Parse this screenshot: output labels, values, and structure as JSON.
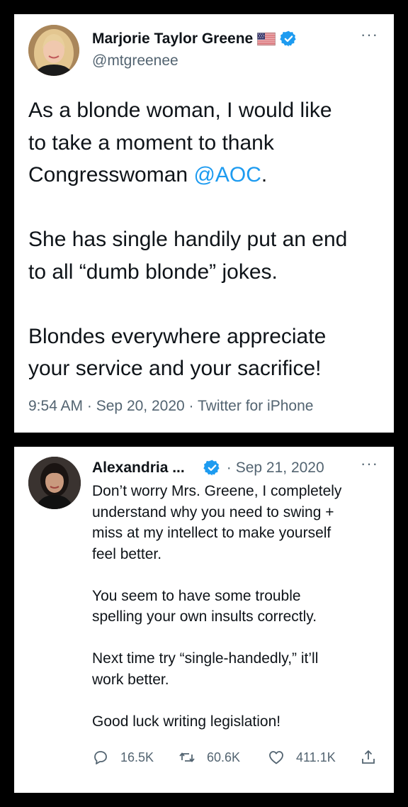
{
  "tweet_1": {
    "display_name": "Marjorie Taylor Greene",
    "handle": "@mtgreenee",
    "text_before_mention": "As a blonde woman, I would like\nto take a moment to thank\nCongresswoman ",
    "mention": "@AOC",
    "text_after_mention": ".\n\nShe has single handily put an end\nto all “dumb blonde” jokes.\n\nBlondes everywhere appreciate\nyour service and your sacrifice!",
    "time": "9:54 AM",
    "date": "Sep 20, 2020",
    "source": "Twitter for iPhone",
    "meta_separator": "·",
    "more_label": "···"
  },
  "tweet_2": {
    "display_name": "Alexandria ...",
    "date_separator": "·",
    "date": "Sep 21, 2020",
    "text": "Don’t worry Mrs. Greene, I completely\nunderstand why you need to swing +\nmiss at my intellect to make yourself\nfeel better.\n\nYou seem to have some trouble\nspelling your own insults correctly.\n\nNext time try “single-handedly,” it’ll\nwork better.\n\nGood luck writing legislation!",
    "more_label": "···",
    "replies": "16.5K",
    "retweets": "60.6K",
    "likes": "411.1K"
  },
  "colors": {
    "link": "#1d9bf0",
    "secondary_text": "#536471",
    "verified_badge": "#1d9bf0"
  },
  "icons": [
    "us-flag-icon",
    "verified-badge-icon",
    "more-icon",
    "reply-icon",
    "retweet-icon",
    "like-icon",
    "share-icon"
  ]
}
